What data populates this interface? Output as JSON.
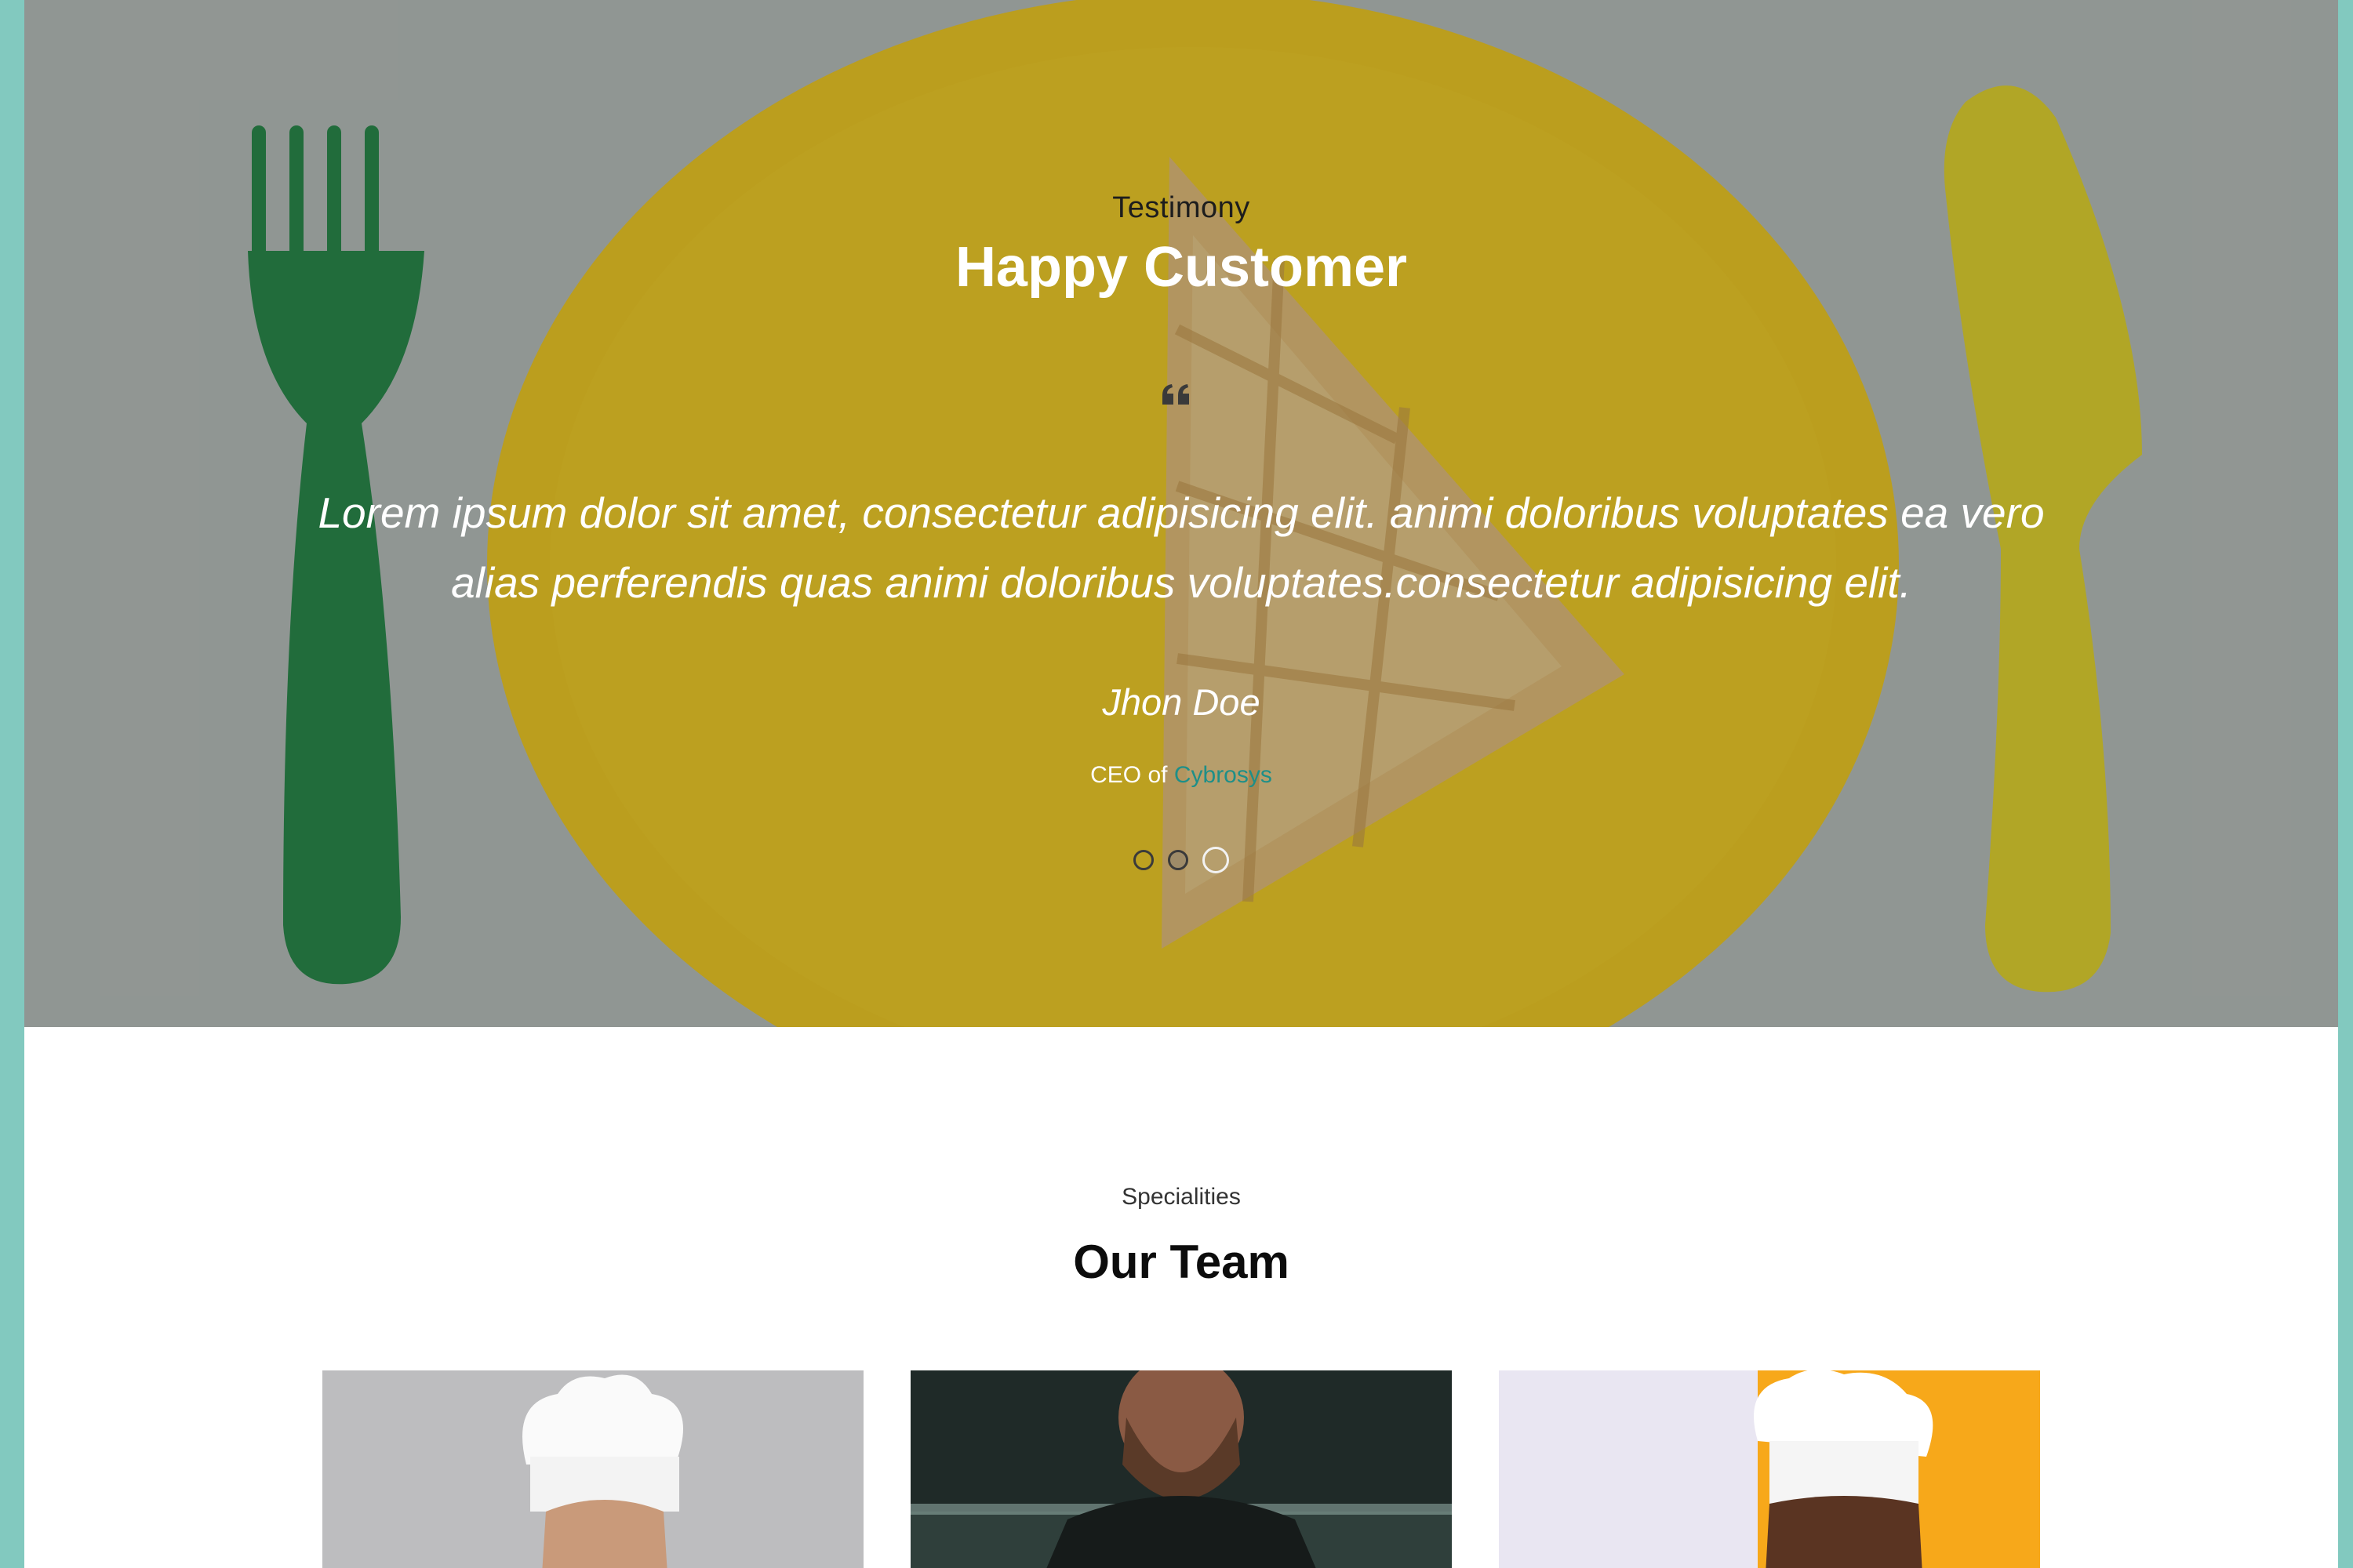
{
  "testimony": {
    "eyebrow": "Testimony",
    "title": "Happy Customer",
    "quote": "Lorem ipsum dolor sit amet, consectetur adipisicing elit. animi doloribus voluptates ea vero alias perferendis quas animi doloribus voluptates.consectetur adipisicing elit.",
    "author": "Jhon Doe",
    "role_prefix": "CEO of",
    "company": "Cybrosys",
    "slides": [
      {
        "label": "slide-1",
        "active": false
      },
      {
        "label": "slide-2",
        "active": false
      },
      {
        "label": "slide-3",
        "active": true
      }
    ],
    "quote_icon": "quote-left-icon"
  },
  "team": {
    "eyebrow": "Specialities",
    "title": "Our Team",
    "members": [
      {
        "photo": "chef-white-hat-photo"
      },
      {
        "photo": "bearded-chef-photo"
      },
      {
        "photo": "chef-orange-background-photo"
      }
    ]
  },
  "colors": {
    "accent": "#82c9bf",
    "link": "#1e8f88",
    "plate_yellow": "#f2c31a",
    "fork_green": "#1d7a3f"
  }
}
